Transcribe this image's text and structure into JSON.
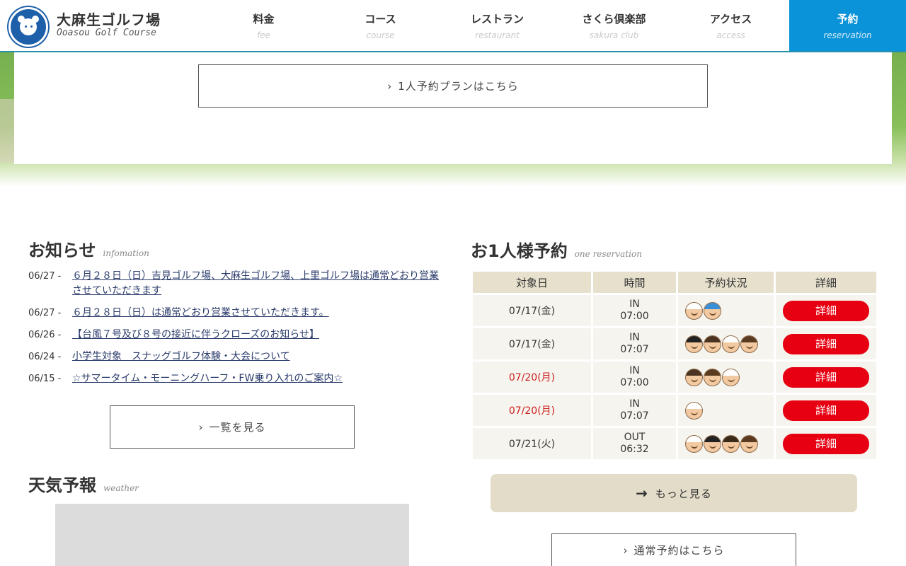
{
  "header": {
    "title": "大麻生ゴルフ場",
    "subtitle": "Ooasou Golf Course",
    "nav": [
      {
        "jp": "料金",
        "en": "fee"
      },
      {
        "jp": "コース",
        "en": "course"
      },
      {
        "jp": "レストラン",
        "en": "restaurant"
      },
      {
        "jp": "さくら倶楽部",
        "en": "sakura club"
      },
      {
        "jp": "アクセス",
        "en": "access"
      },
      {
        "jp": "予約",
        "en": "reservation"
      }
    ]
  },
  "hero": {
    "single_plan_button": "1人予約プランはこちら"
  },
  "news": {
    "title": "お知らせ",
    "title_en": "infomation",
    "items": [
      {
        "date": "06/27 -",
        "text": "６月２８日（日）吉見ゴルフ場、大麻生ゴルフ場、上里ゴルフ場は通常どおり営業させていただきます"
      },
      {
        "date": "06/27 -",
        "text": "６月２８日（日）は通常どおり営業させていただきます。"
      },
      {
        "date": "06/26 -",
        "text": "【台風７号及び８号の接近に伴うクローズのお知らせ】"
      },
      {
        "date": "06/24 -",
        "text": "小学生対象　スナッグゴルフ体験・大会について"
      },
      {
        "date": "06/15 -",
        "text": "☆サマータイム・モーニングハーフ・FW乗り入れのご案内☆"
      }
    ],
    "list_button": "一覧を見る"
  },
  "weather": {
    "title": "天気予報",
    "title_en": "weather"
  },
  "reservation": {
    "title": "お1人様予約",
    "title_en": "one reservation",
    "headers": [
      "対象日",
      "時間",
      "予約状況",
      "詳細"
    ],
    "rows": [
      {
        "date": "07/17(金)",
        "course": "IN",
        "time": "07:00",
        "players": 2,
        "detail": "詳細"
      },
      {
        "date": "07/17(金)",
        "course": "IN",
        "time": "07:07",
        "players": 4,
        "detail": "詳細"
      },
      {
        "date": "07/20(月)",
        "course": "IN",
        "time": "07:00",
        "players": 3,
        "detail": "詳細"
      },
      {
        "date": "07/20(月)",
        "course": "IN",
        "time": "07:07",
        "players": 1,
        "detail": "詳細"
      },
      {
        "date": "07/21(火)",
        "course": "OUT",
        "time": "06:32",
        "players": 4,
        "detail": "詳細"
      }
    ],
    "more_button": "もっと見る",
    "normal_button": "通常予約はこちら"
  },
  "colors": {
    "accent": "#0b93d9",
    "detail_button": "#e60012",
    "holiday_date": "#cc1f1f",
    "table_header": "#e6e0cc"
  },
  "icons": {
    "logo": "koala-logo-icon",
    "chevron": "chevron-right-icon",
    "arrow": "arrow-right-icon"
  }
}
